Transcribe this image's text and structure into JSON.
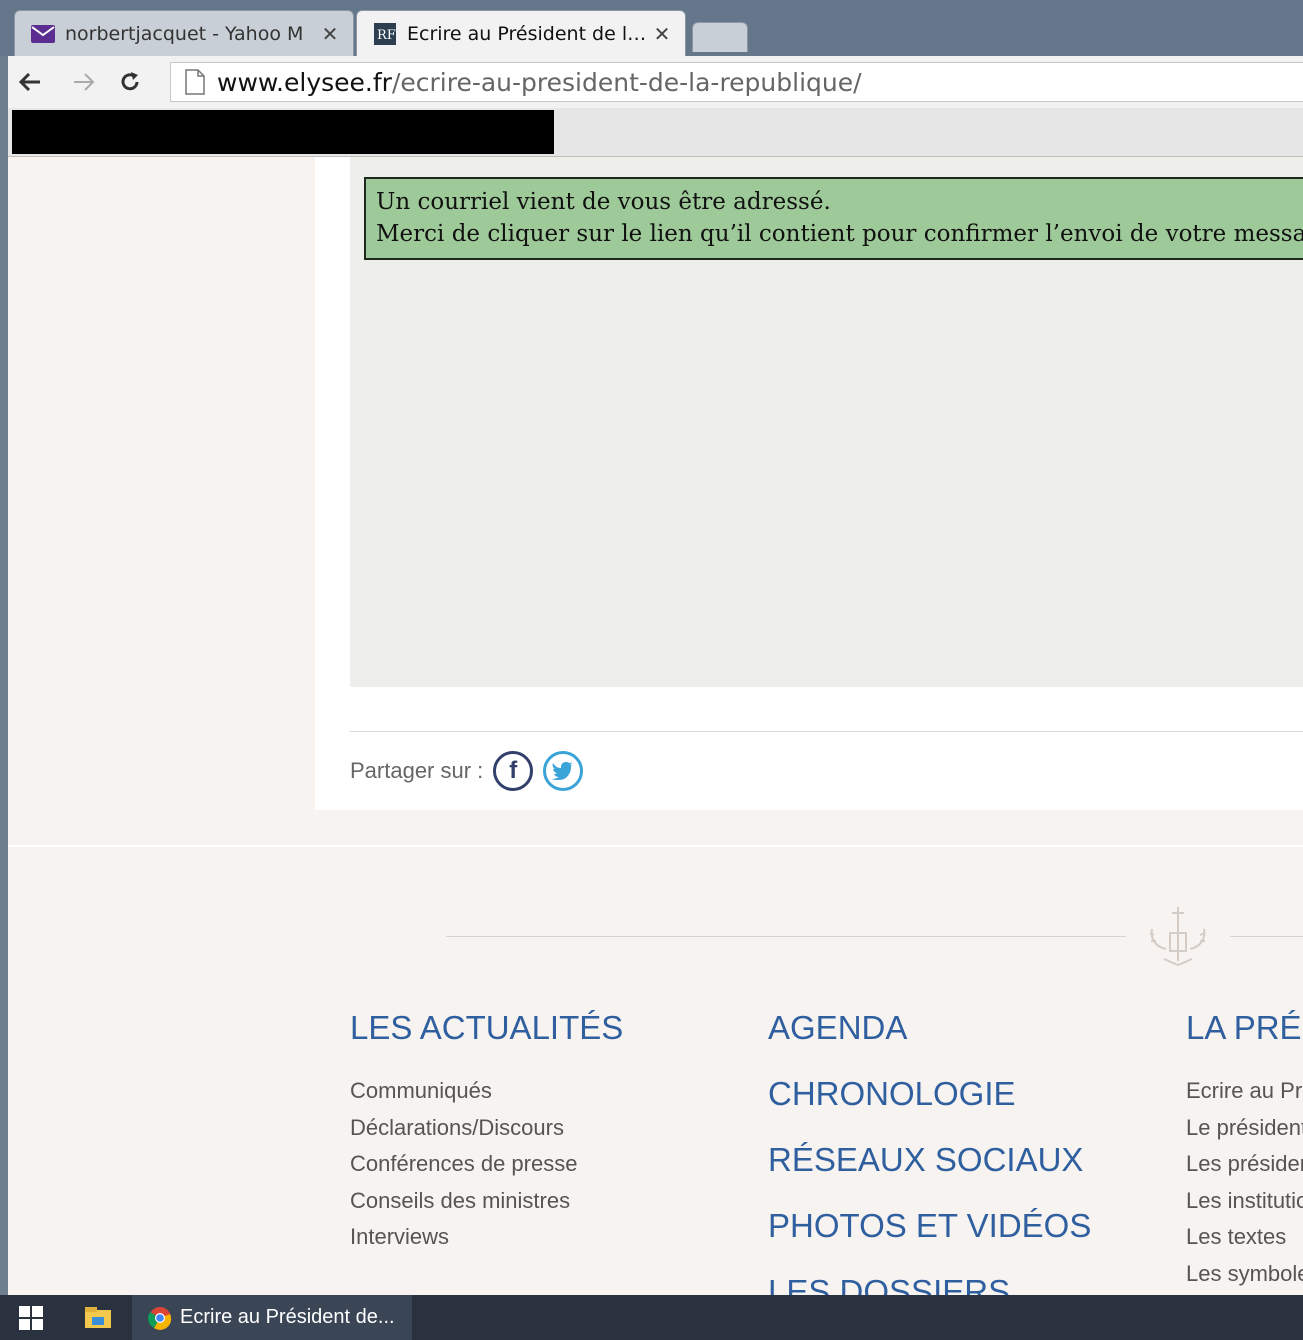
{
  "browser": {
    "tabs": [
      {
        "title": "norbertjacquet - Yahoo M",
        "favicon": "mail-icon",
        "active": false
      },
      {
        "title": "Ecrire au Président de la R",
        "favicon": "rf-logo-icon",
        "active": true
      }
    ],
    "close_glyph": "✕",
    "url_host": "www.elysee.fr",
    "url_path": "/ecrire-au-president-de-la-republique/"
  },
  "notice": {
    "line1": "Un courriel vient de vous être adressé.",
    "line2": "Merci de cliquer sur le lien qu’il contient pour confirmer l’envoi de votre message."
  },
  "share": {
    "label": "Partager sur :"
  },
  "footer": {
    "col1": {
      "title": "LES ACTUALITÉS",
      "links": [
        "Communiqués",
        "Déclarations/Discours",
        "Conférences de presse",
        "Conseils des ministres",
        "Interviews"
      ]
    },
    "col2": {
      "headings": [
        "AGENDA",
        "CHRONOLOGIE",
        "RÉSEAUX SOCIAUX",
        "PHOTOS ET VIDÉOS",
        "LES DOSSIERS"
      ]
    },
    "col3": {
      "title": "LA PRÉSIDENCE",
      "links": [
        "Ecrire au Président",
        "Le président",
        "Les présidents",
        "Les institutions",
        "Les textes",
        "Les symboles"
      ]
    }
  },
  "taskbar": {
    "chrome_label": "Ecrire au Président de..."
  },
  "colors": {
    "notice_bg": "#9ec998",
    "footer_heading": "#2f5f9f",
    "facebook": "#33406b",
    "twitter": "#3aa3d8"
  }
}
